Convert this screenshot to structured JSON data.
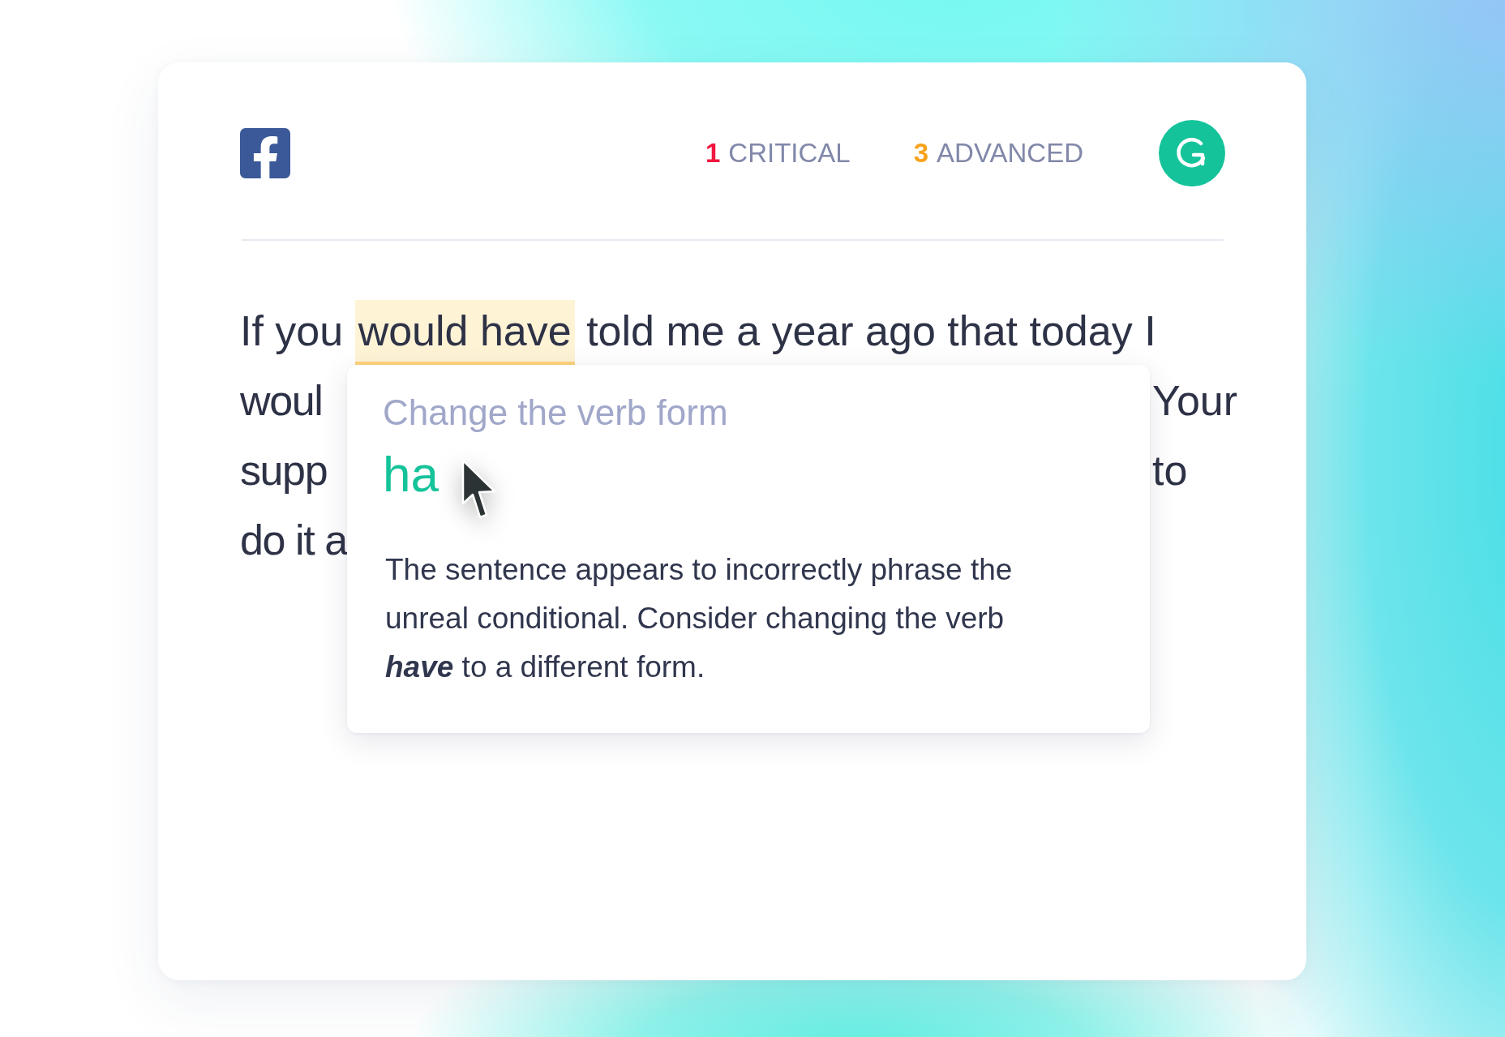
{
  "header": {
    "issue_counts": [
      {
        "count": "1",
        "label": "CRITICAL",
        "color": "#f0163f"
      },
      {
        "count": "3",
        "label": "ADVANCED",
        "color": "#f7a21b"
      }
    ]
  },
  "editor": {
    "lines": [
      {
        "left": [
          {
            "text": "If you ",
            "highlighted": false
          },
          {
            "text": "would have",
            "highlighted": true
          },
          {
            "text": " told me a year ago that today I",
            "highlighted": false
          }
        ]
      },
      {
        "left": [
          {
            "text": "woul",
            "highlighted": false
          }
        ],
        "right": "Your"
      },
      {
        "left": [
          {
            "text": "supp",
            "highlighted": false
          }
        ],
        "right": "to"
      },
      {
        "left": [
          {
            "text": "do it a",
            "highlighted": false
          }
        ]
      }
    ]
  },
  "suggestion_card": {
    "title": "Change the verb form",
    "replacement": "ha",
    "explanation": "The sentence appears to incorrectly phrase the unreal conditional. Consider changing the verb **have** to a different form."
  }
}
